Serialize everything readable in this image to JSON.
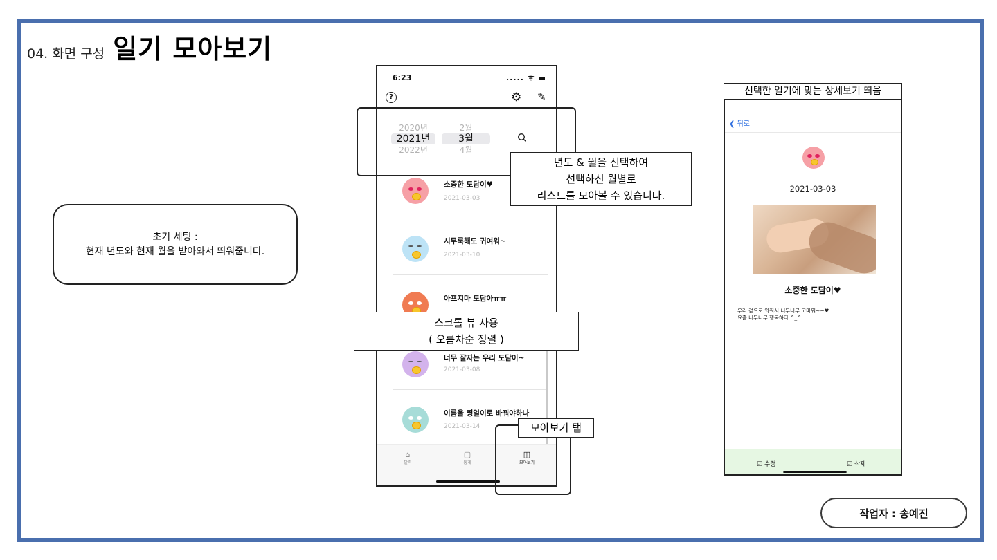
{
  "page": {
    "title_prefix": "04. 화면 구성",
    "title_main": "일기 모아보기",
    "author": "작업자 : 송예진"
  },
  "callouts": {
    "initial_setting": {
      "line1": "초기 세팅 :",
      "line2": "현재 년도와 현재 월을 받아와서 띄워줍니다."
    },
    "year_month": {
      "line1": "년도 & 월을 선택하여",
      "line2": "선택하신 월별로",
      "line3": "리스트를 모아볼 수 있습니다."
    },
    "scroll_view": {
      "line1": "스크롤 뷰 사용",
      "line2": "( 오름차순 정렬 )"
    },
    "tab": {
      "label": "모아보기 탭"
    },
    "detail": {
      "label": "선택한 일기에 맞는 상세보기 띄움"
    }
  },
  "list_phone": {
    "status_time": "6:23",
    "status_right": "..... ᯤ ▬",
    "help_icon": "?",
    "settings_icon": "gear-icon",
    "edit_icon": "compose-icon",
    "years": [
      "2020년",
      "2021년",
      "2022년"
    ],
    "months": [
      "2월",
      "3월",
      "4월"
    ],
    "items": [
      {
        "title": "소중한 도담이♥",
        "date": "2021-03-03",
        "color": "#f6a0a6"
      },
      {
        "title": "시무룩해도 귀여워~",
        "date": "2021-03-10",
        "color": "#bde3f6"
      },
      {
        "title": "아프지마 도담아ㅠㅠ",
        "date": "",
        "color": "#f07b52"
      },
      {
        "title": "너무 잘자는 우리 도담이~",
        "date": "2021-03-08",
        "color": "#d3b3ec"
      },
      {
        "title": "이름을 찡얼이로 바꿔야하나",
        "date": "2021-03-14",
        "color": "#a7dcd8"
      }
    ],
    "tabs": [
      {
        "label": "달력",
        "icon": "🏠"
      },
      {
        "label": "통계",
        "icon": "▢"
      },
      {
        "label": "모아보기",
        "icon": "📖"
      }
    ]
  },
  "detail_phone": {
    "back_label": "뒤로",
    "date": "2021-03-03",
    "title": "소중한 도담이♥",
    "body_line1": "우리 곁으로 와줘서 너무너무 고마워~~♥",
    "body_line2": "요즘 너무너무 행복하다 ^_^",
    "edit_label": "수정",
    "delete_label": "삭제",
    "bottom_color": "#e6f7e3"
  },
  "colors": {
    "frame": "#4a6fae",
    "link": "#2f6fe0"
  }
}
